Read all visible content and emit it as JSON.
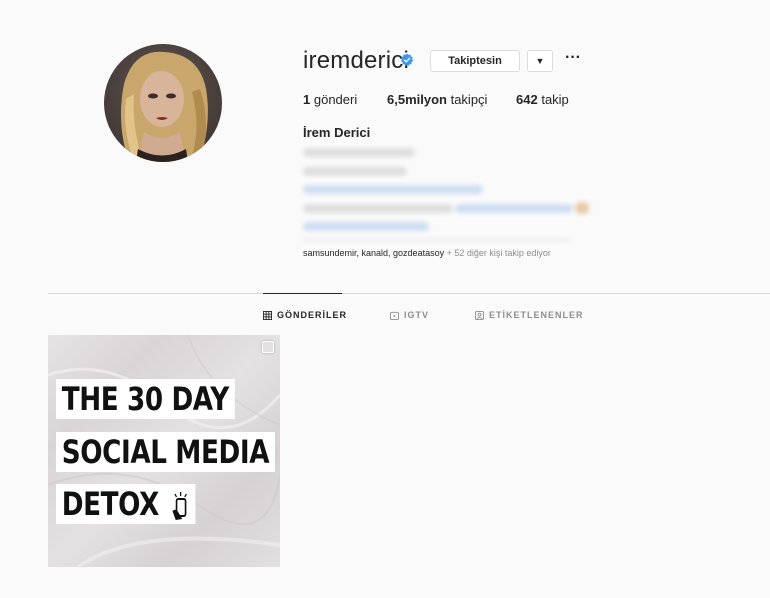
{
  "profile": {
    "username": "iremderici",
    "follow_label": "Takiptesin",
    "dropdown_icon": "chevron-down-icon",
    "more_icon": "more-options-icon",
    "full_name": "İrem Derici",
    "stats": {
      "posts_count": "1",
      "posts_label": "gönderi",
      "followers_count": "6,5milyon",
      "followers_label": "takipçi",
      "following_count": "642",
      "following_label": "takip"
    },
    "followed_by": {
      "names": "samsundemir, kanald, gozdeatasoy",
      "rest": "+ 52 diğer kişi takip ediyor"
    }
  },
  "tabs": [
    {
      "label": "GÖNDERİLER",
      "icon": "grid-icon",
      "active": true
    },
    {
      "label": "IGTV",
      "icon": "igtv-icon",
      "active": false
    },
    {
      "label": "ETİKETLENENLER",
      "icon": "tagged-icon",
      "active": false
    }
  ],
  "post": {
    "lines": [
      "THE 30 DAY",
      "SOCIAL MEDIA",
      "DETOX"
    ],
    "icon": "phone-hand-icon"
  },
  "colors": {
    "verified": "#3897f0",
    "link_blur": "#a9c7ec",
    "text_blur": "#c7c7c7"
  }
}
